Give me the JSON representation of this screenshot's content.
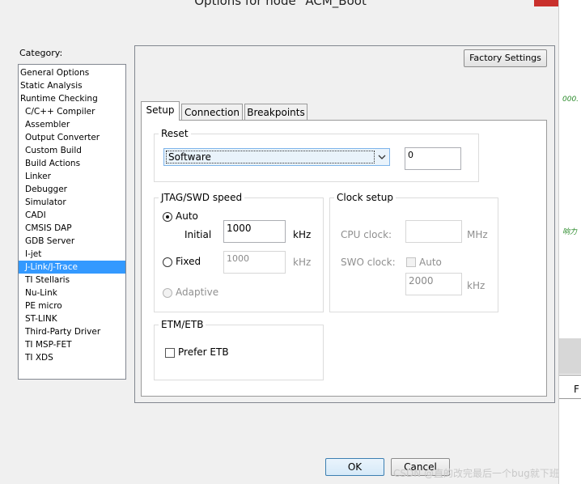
{
  "window": {
    "title": "Options for node \"ACM_Boot\""
  },
  "category": {
    "label": "Category:",
    "items": [
      {
        "label": "General Options",
        "indent": false
      },
      {
        "label": "Static Analysis",
        "indent": false
      },
      {
        "label": "Runtime Checking",
        "indent": false
      },
      {
        "label": "C/C++ Compiler",
        "indent": true
      },
      {
        "label": "Assembler",
        "indent": true
      },
      {
        "label": "Output Converter",
        "indent": true
      },
      {
        "label": "Custom Build",
        "indent": true
      },
      {
        "label": "Build Actions",
        "indent": true
      },
      {
        "label": "Linker",
        "indent": true
      },
      {
        "label": "Debugger",
        "indent": true
      },
      {
        "label": "Simulator",
        "indent": true
      },
      {
        "label": "CADI",
        "indent": true
      },
      {
        "label": "CMSIS DAP",
        "indent": true
      },
      {
        "label": "GDB Server",
        "indent": true
      },
      {
        "label": "I-jet",
        "indent": true
      },
      {
        "label": "J-Link/J-Trace",
        "indent": true,
        "selected": true
      },
      {
        "label": "TI Stellaris",
        "indent": true
      },
      {
        "label": "Nu-Link",
        "indent": true
      },
      {
        "label": "PE micro",
        "indent": true
      },
      {
        "label": "ST-LINK",
        "indent": true
      },
      {
        "label": "Third-Party Driver",
        "indent": true
      },
      {
        "label": "TI MSP-FET",
        "indent": true
      },
      {
        "label": "TI XDS",
        "indent": true
      }
    ]
  },
  "panel": {
    "factory_settings": "Factory Settings",
    "tabs": [
      {
        "label": "Setup",
        "active": true
      },
      {
        "label": "Connection",
        "active": false
      },
      {
        "label": "Breakpoints",
        "active": false
      }
    ]
  },
  "reset": {
    "title": "Reset",
    "selected": "Software",
    "delay": "0"
  },
  "jtag": {
    "title": "JTAG/SWD speed",
    "auto_label": "Auto",
    "initial_label": "Initial",
    "initial_value": "1000",
    "initial_unit": "kHz",
    "fixed_label": "Fixed",
    "fixed_value": "1000",
    "fixed_unit": "kHz",
    "adaptive_label": "Adaptive"
  },
  "clock": {
    "title": "Clock setup",
    "cpu_label": "CPU clock:",
    "cpu_value": "",
    "cpu_unit": "MHz",
    "swo_label": "SWO clock:",
    "swo_auto_label": "Auto",
    "swo_value": "2000",
    "swo_unit": "kHz"
  },
  "etm": {
    "title": "ETM/ETB",
    "prefer_label": "Prefer ETB"
  },
  "buttons": {
    "ok": "OK",
    "cancel": "Cancel"
  },
  "background_strip": {
    "text1": "000.",
    "text2": "响力",
    "text3": "F"
  },
  "watermark": "CSDN @直的改完最后一个bug就下班"
}
